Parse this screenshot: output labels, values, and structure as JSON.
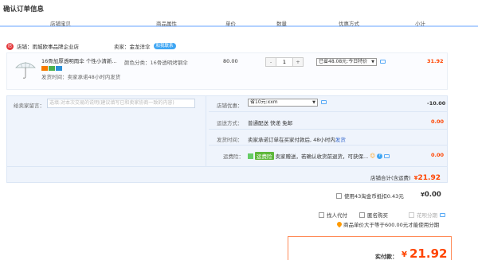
{
  "page": {
    "title": "确认订单信息"
  },
  "columns": [
    "店铺宝贝",
    "商品属性",
    "单价",
    "数量",
    "优惠方式",
    "小计"
  ],
  "shop": {
    "icon_text": "店",
    "label": "店铺：",
    "name": "雨城欧事品牌企业店",
    "seller_label": "卖家：",
    "seller_name": "金龙洋伞",
    "contact_label": "和我联系"
  },
  "item": {
    "title": "16骨加厚透明雨伞 个性小清新...",
    "attr_label": "颜色分类：",
    "attr_value": "16骨透明烤钢伞",
    "ship_label": "发货时间：",
    "ship_value": "卖家承诺48小时内发货",
    "price": "80.00",
    "qty": "1",
    "qty_minus": "-",
    "qty_plus": "+",
    "promo_select": "已省48.08元:今日特价",
    "subtotal": "31.92"
  },
  "message": {
    "label": "给卖家留言：",
    "placeholder": "选填:对本次交易的说明(建议填写已和卖家协商一致的内容)"
  },
  "shop_discount": {
    "label": "店铺优惠：",
    "select": "省10元:xxm",
    "value": "-10.00"
  },
  "shipping": {
    "label": "运送方式：",
    "value": "普通配送 快递 免邮",
    "price": "0.00"
  },
  "delivery": {
    "label": "发货时间：",
    "value": "卖家承诺订单在买家付款后, 48小时内",
    "link": "发货"
  },
  "insurance": {
    "label": "运费险：",
    "tag": "运费险",
    "text": "卖家赠送，若确认收货前退货，可获保...",
    "emoji": "☺",
    "price": "0.00"
  },
  "shop_total": {
    "label": "店铺合计(含运费)",
    "currency": "¥",
    "value": "21.92"
  },
  "coins": {
    "label": "使用43淘金币抵扣0.43元",
    "currency": "¥",
    "value": "0.00"
  },
  "options": {
    "proxy_label": "找人代付",
    "anon_label": "匿名购买",
    "huabei_label": "花呗分期"
  },
  "notice": {
    "text": "商品单价大于等于600.00元才能使用分期"
  },
  "payment": {
    "label": "实付款：",
    "currency": "¥",
    "value": "21.92"
  },
  "colors": {
    "accent": "#f40",
    "header_line": "#b2d1ff",
    "pay_border": "#ff8a57"
  }
}
